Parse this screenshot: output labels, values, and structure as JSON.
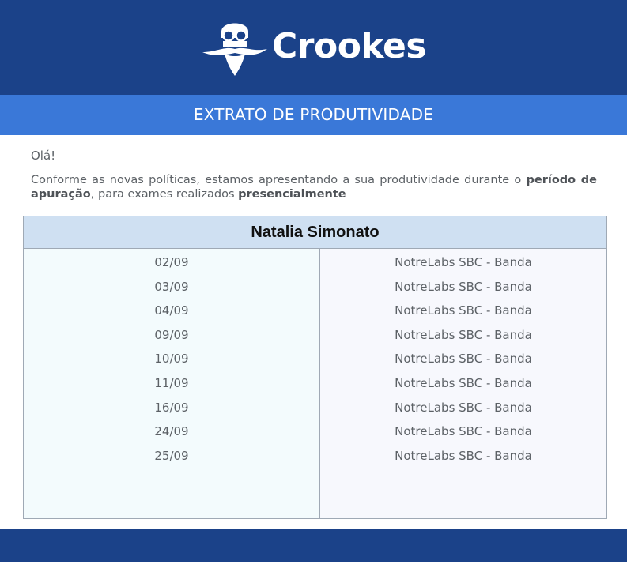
{
  "header": {
    "brand_name": "Crookes",
    "logo_icon": "professor-glasses-beard-icon",
    "background": "#1b4289"
  },
  "banner": {
    "title": "EXTRATO DE PRODUTIVIDADE",
    "background": "#3a78d8"
  },
  "message": {
    "greeting": "Olá!",
    "intro_part1": "Conforme as novas políticas, estamos apresentando a sua produtividade durante o ",
    "intro_bold1": "período de apuração",
    "intro_part2": ", para exames realizados ",
    "intro_bold2": "presencialmente"
  },
  "table": {
    "person_name": "Natalia Simonato",
    "rows": [
      {
        "date": "02/09",
        "location": "NotreLabs SBC - Banda"
      },
      {
        "date": "03/09",
        "location": "NotreLabs SBC - Banda"
      },
      {
        "date": "04/09",
        "location": "NotreLabs SBC - Banda"
      },
      {
        "date": "09/09",
        "location": "NotreLabs SBC - Banda"
      },
      {
        "date": "10/09",
        "location": "NotreLabs SBC - Banda"
      },
      {
        "date": "11/09",
        "location": "NotreLabs SBC - Banda"
      },
      {
        "date": "16/09",
        "location": "NotreLabs SBC - Banda"
      },
      {
        "date": "24/09",
        "location": "NotreLabs SBC - Banda"
      },
      {
        "date": "25/09",
        "location": "NotreLabs SBC - Banda"
      }
    ],
    "header_color": "#cfe0f2"
  },
  "footer": {
    "background": "#1b4289"
  }
}
